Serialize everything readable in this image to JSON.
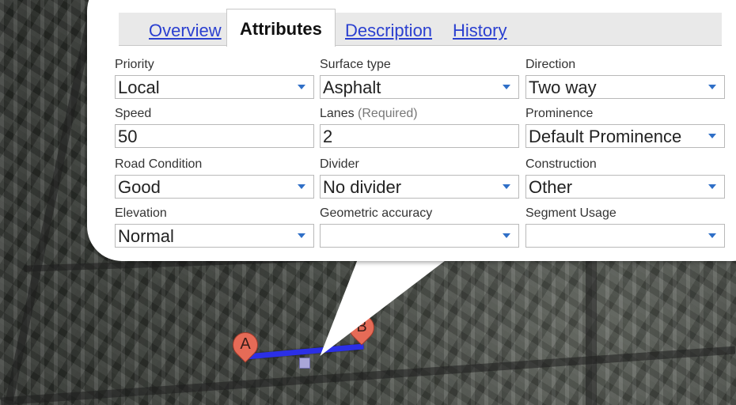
{
  "tabs": {
    "overview": "Overview",
    "attributes": "Attributes",
    "description": "Description",
    "history": "History"
  },
  "fields": {
    "priority": {
      "label": "Priority",
      "value": "Local"
    },
    "surface_type": {
      "label": "Surface type",
      "value": "Asphalt"
    },
    "direction": {
      "label": "Direction",
      "value": "Two way"
    },
    "speed": {
      "label": "Speed",
      "value": "50"
    },
    "lanes": {
      "label": "Lanes",
      "required": "(Required)",
      "value": "2"
    },
    "prominence": {
      "label": "Prominence",
      "value": "Default Prominence"
    },
    "road_condition": {
      "label": "Road Condition",
      "value": "Good"
    },
    "divider": {
      "label": "Divider",
      "value": "No divider"
    },
    "construction": {
      "label": "Construction",
      "value": "Other"
    },
    "elevation": {
      "label": "Elevation",
      "value": "Normal"
    },
    "geometric_accuracy": {
      "label": "Geometric accuracy",
      "value": ""
    },
    "segment_usage": {
      "label": "Segment Usage",
      "value": ""
    }
  },
  "markers": {
    "a": "A",
    "b": "B"
  },
  "colors": {
    "link": "#2a3fd0",
    "route": "#2b2fe6",
    "marker": "#e66b57",
    "dropdown_arrow": "#2f6fc7"
  }
}
